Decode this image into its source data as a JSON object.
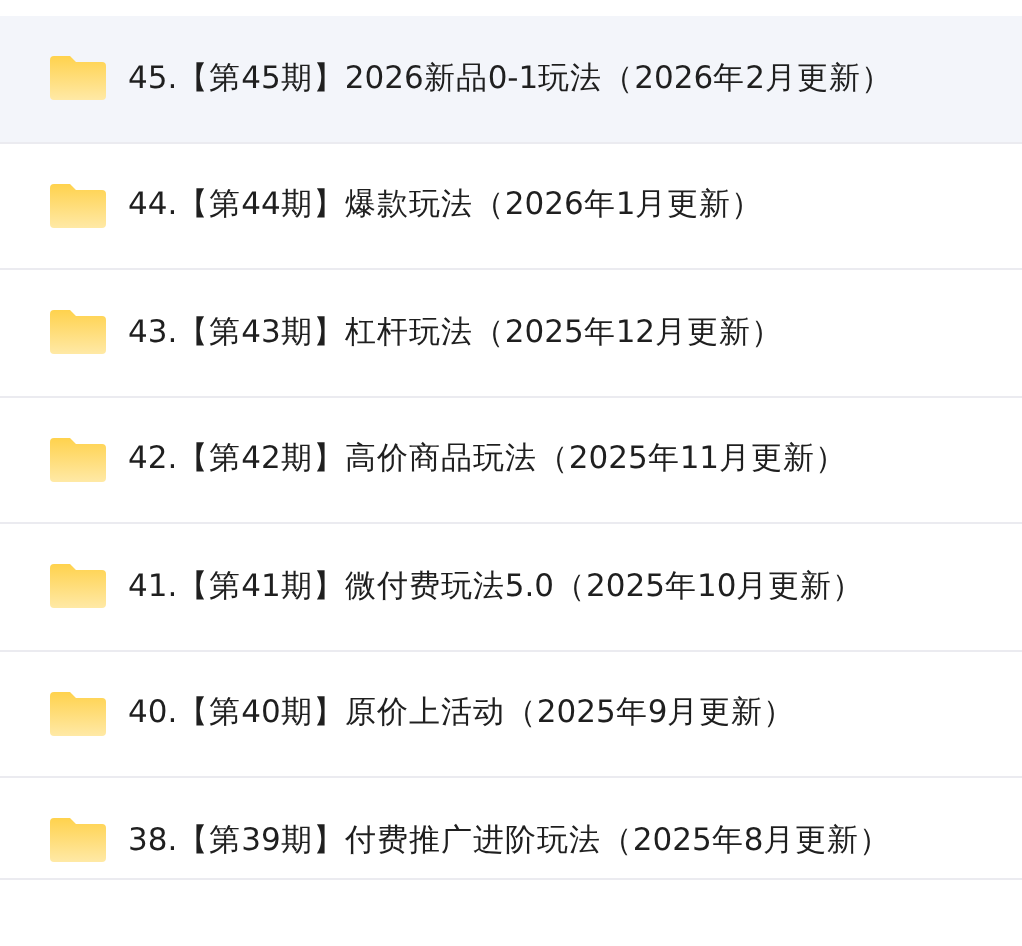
{
  "items": [
    {
      "title": "45.【第45期】2026新品0-1玩法（2026年2月更新）",
      "selected": true
    },
    {
      "title": "44.【第44期】爆款玩法（2026年1月更新）",
      "selected": false
    },
    {
      "title": "43.【第43期】杠杆玩法（2025年12月更新）",
      "selected": false
    },
    {
      "title": "42.【第42期】高价商品玩法（2025年11月更新）",
      "selected": false
    },
    {
      "title": "41.【第41期】微付费玩法5.0（2025年10月更新）",
      "selected": false
    },
    {
      "title": "40.【第40期】原价上活动（2025年9月更新）",
      "selected": false
    },
    {
      "title": "38.【第39期】付费推广进阶玩法（2025年8月更新）",
      "selected": false
    }
  ]
}
